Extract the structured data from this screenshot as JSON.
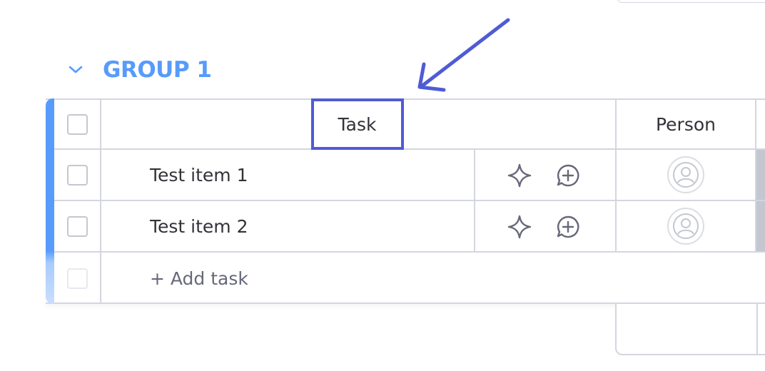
{
  "group": {
    "title": "GROUP 1",
    "color": "#579bfc"
  },
  "columns": {
    "task": "Task",
    "person": "Person"
  },
  "rows": [
    {
      "name": "Test item 1"
    },
    {
      "name": "Test item 2"
    }
  ],
  "add_task_label": "+ Add task",
  "annotation": {
    "highlight_color": "#4f5bd5"
  },
  "icons": {
    "collapse": "chevron-down-icon",
    "sparkle": "sparkle-icon",
    "add_update": "comment-plus-icon",
    "person": "person-avatar-icon"
  }
}
